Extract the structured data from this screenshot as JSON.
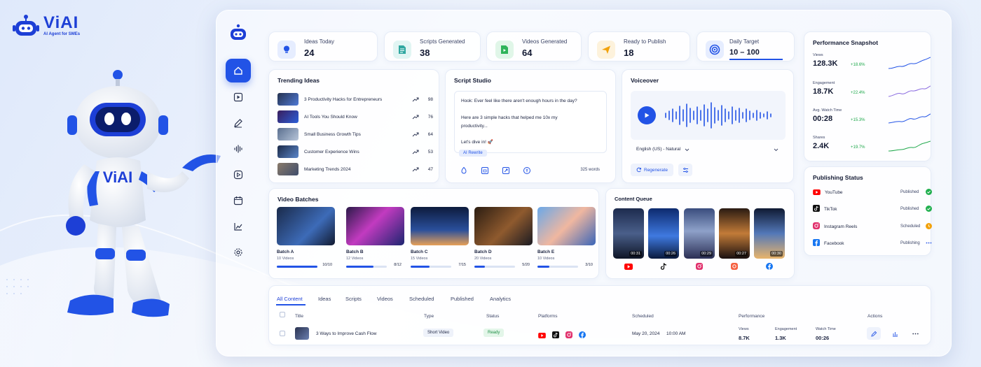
{
  "brand": {
    "name": "ViAI",
    "tagline": "AI Agent for SMEs",
    "robot_badge": "ViAI",
    "accent": "#2253e6"
  },
  "stats": [
    {
      "label": "Ideas Today",
      "value": "24",
      "icon": "lightbulb-icon",
      "color": "#2253e6"
    },
    {
      "label": "Scripts Generated",
      "value": "38",
      "icon": "document-icon",
      "color": "#2fa7a0"
    },
    {
      "label": "Videos Generated",
      "value": "64",
      "icon": "video-file-icon",
      "color": "#2fb45a"
    },
    {
      "label": "Ready to Publish",
      "value": "18",
      "icon": "send-icon",
      "color": "#f2a20c"
    },
    {
      "label": "Daily Target",
      "value": "10 – 100",
      "icon": "target-icon",
      "color": "#2253e6"
    }
  ],
  "trending": {
    "title": "Trending Ideas",
    "items": [
      {
        "title": "3 Productivity Hacks for Entrepreneurs",
        "score": "98"
      },
      {
        "title": "AI Tools You Should Know",
        "score": "76"
      },
      {
        "title": "Small Business Growth Tips",
        "score": "64"
      },
      {
        "title": "Customer Experience Wins",
        "score": "53"
      },
      {
        "title": "Marketing Trends 2024",
        "score": "47"
      }
    ]
  },
  "script": {
    "title": "Script Studio",
    "line1": "Hook: Ever feel like there aren't enough hours in the day?",
    "line2": "Here are 3 simple hacks that helped me 10x my",
    "line3": "productivity...",
    "line4": "Let's dive in! 🚀",
    "rewrite": "AI Rewrite",
    "words": "325 words"
  },
  "voiceover": {
    "title": "Voiceover",
    "voice": "English (US) - Natural",
    "regenerate": "Regenerate"
  },
  "batches": {
    "title": "Video Batches",
    "items": [
      {
        "name": "Batch A",
        "videos": "10 Videos",
        "progress": "10/10",
        "fraction": 1.0
      },
      {
        "name": "Batch B",
        "videos": "12 Videos",
        "progress": "8/12",
        "fraction": 0.667
      },
      {
        "name": "Batch C",
        "videos": "15 Videos",
        "progress": "7/15",
        "fraction": 0.467
      },
      {
        "name": "Batch D",
        "videos": "20 Videos",
        "progress": "5/20",
        "fraction": 0.25
      },
      {
        "name": "Batch E",
        "videos": "10 Videos",
        "progress": "3/10",
        "fraction": 0.3
      }
    ]
  },
  "queue": {
    "title": "Content Queue",
    "items": [
      {
        "duration": "00:31",
        "platform": "youtube-icon"
      },
      {
        "duration": "00:26",
        "platform": "tiktok-icon"
      },
      {
        "duration": "00:29",
        "platform": "instagram-icon"
      },
      {
        "duration": "00:27",
        "platform": "instagram-reels-icon"
      },
      {
        "duration": "00:30",
        "platform": "facebook-icon"
      }
    ]
  },
  "performance": {
    "title": "Performance Snapshot",
    "items": [
      {
        "label": "Views",
        "value": "128.3K",
        "delta": "+18.6%",
        "color": "#2253e6"
      },
      {
        "label": "Engagement",
        "value": "18.7K",
        "delta": "+22.4%",
        "color": "#8a6be0"
      },
      {
        "label": "Avg. Watch Time",
        "value": "00:28",
        "delta": "+15.3%",
        "color": "#2253e6"
      },
      {
        "label": "Shares",
        "value": "2.4K",
        "delta": "+19.7%",
        "color": "#1ea84b"
      }
    ]
  },
  "publishing": {
    "title": "Publishing Status",
    "items": [
      {
        "name": "YouTube",
        "status": "Published",
        "icon": "youtube-icon",
        "state": "done"
      },
      {
        "name": "TikTok",
        "status": "Published",
        "icon": "tiktok-icon",
        "state": "done"
      },
      {
        "name": "Instagram Reels",
        "status": "Scheduled",
        "icon": "instagram-icon",
        "state": "scheduled"
      },
      {
        "name": "Facebook",
        "status": "Publishing",
        "icon": "facebook-icon",
        "state": "publishing"
      }
    ]
  },
  "table": {
    "tabs": [
      "All Content",
      "Ideas",
      "Scripts",
      "Videos",
      "Scheduled",
      "Published",
      "Analytics"
    ],
    "headers": {
      "title": "Title",
      "type": "Type",
      "status": "Status",
      "platforms": "Platforms",
      "scheduled": "Scheduled",
      "performance": "Performance",
      "actions": "Actions"
    },
    "row": {
      "title": "3 Ways to Improve Cash Flow",
      "type": "Short Video",
      "status": "Ready",
      "date": "May 20, 2024",
      "time": "10:00 AM",
      "views_label": "Views",
      "views": "8.7K",
      "engagement_label": "Engagement",
      "engagement": "1.3K",
      "watch_label": "Watch Time",
      "watch": "00:26"
    }
  }
}
